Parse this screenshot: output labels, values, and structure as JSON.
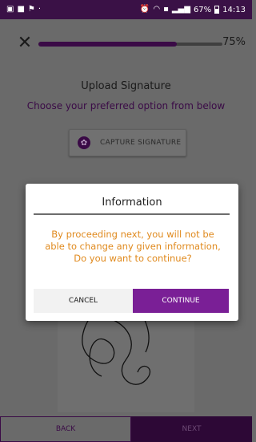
{
  "status_bar": {
    "left_icons": [
      "image-icon",
      "message-icon",
      "app-icon"
    ],
    "battery": "67%",
    "time": "14:13"
  },
  "header": {
    "close_icon": "close-icon",
    "progress_percent": 75,
    "progress_label": "75%"
  },
  "main": {
    "title": "Upload Signature",
    "subtitle": "Choose your preferred option from below",
    "capture_button_label": "CAPTURE SIGNATURE",
    "capture_icon": "camera-shutter-icon"
  },
  "dialog": {
    "title": "Information",
    "message": "By proceeding next, you will not be able to change any given information, Do you want to continue?",
    "cancel_label": "CANCEL",
    "continue_label": "CONTINUE"
  },
  "footer": {
    "back_label": "BACK",
    "next_label": "NEXT"
  },
  "colors": {
    "brand": "#3a0a46",
    "accent": "#7a1f96",
    "warning_text": "#e08a1e"
  }
}
